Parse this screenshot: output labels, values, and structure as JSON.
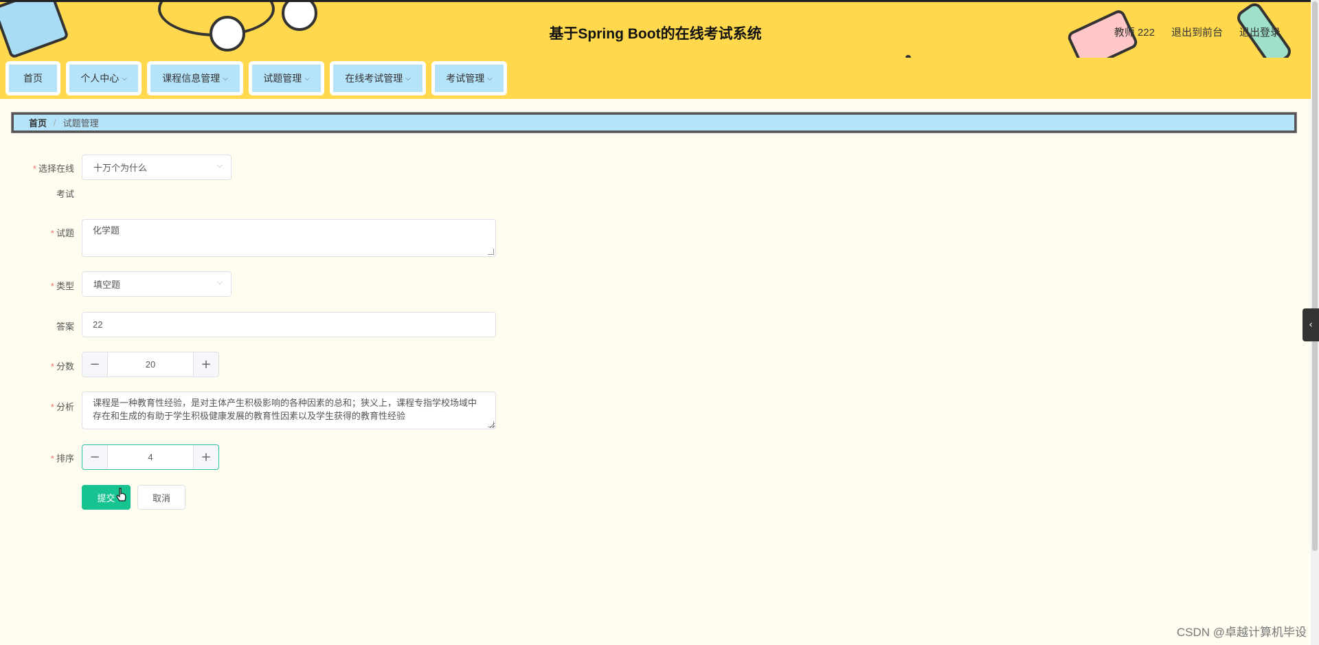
{
  "header": {
    "title": "基于Spring Boot的在线考试系统",
    "user": "教师 222",
    "exit_front": "退出到前台",
    "logout": "退出登录"
  },
  "nav": {
    "items": [
      {
        "label": "首页",
        "has_dropdown": false
      },
      {
        "label": "个人中心",
        "has_dropdown": true
      },
      {
        "label": "课程信息管理",
        "has_dropdown": true
      },
      {
        "label": "试题管理",
        "has_dropdown": true
      },
      {
        "label": "在线考试管理",
        "has_dropdown": true
      },
      {
        "label": "考试管理",
        "has_dropdown": true
      }
    ]
  },
  "breadcrumb": {
    "home": "首页",
    "separator": "/",
    "current": "试题管理"
  },
  "form": {
    "exam_label_line1": "选择在线",
    "exam_label_line2": "考试",
    "exam_value": "十万个为什么",
    "question_label": "试题",
    "question_value": "化学题",
    "type_label": "类型",
    "type_value": "填空题",
    "answer_label": "答案",
    "answer_value": "22",
    "score_label": "分数",
    "score_value": "20",
    "analysis_label": "分析",
    "analysis_value": "课程是一种教育性经验，是对主体产生积极影响的各种因素的总和；狭义上，课程专指学校场域中存在和生成的有助于学生积极健康发展的教育性因素以及学生获得的教育性经验",
    "order_label": "排序",
    "order_value": "4",
    "submit_label": "提交",
    "cancel_label": "取消",
    "required_mark": "*"
  },
  "icons": {
    "minus": "−",
    "plus": "+",
    "chevron": "⌵",
    "toggle": "‹"
  },
  "colors": {
    "header_bg": "#ffd84d",
    "nav_item_bg": "#b5e3fa",
    "submit_bg": "#16c391",
    "required": "#f56c6c"
  },
  "watermark": "CSDN @卓越计算机毕设"
}
